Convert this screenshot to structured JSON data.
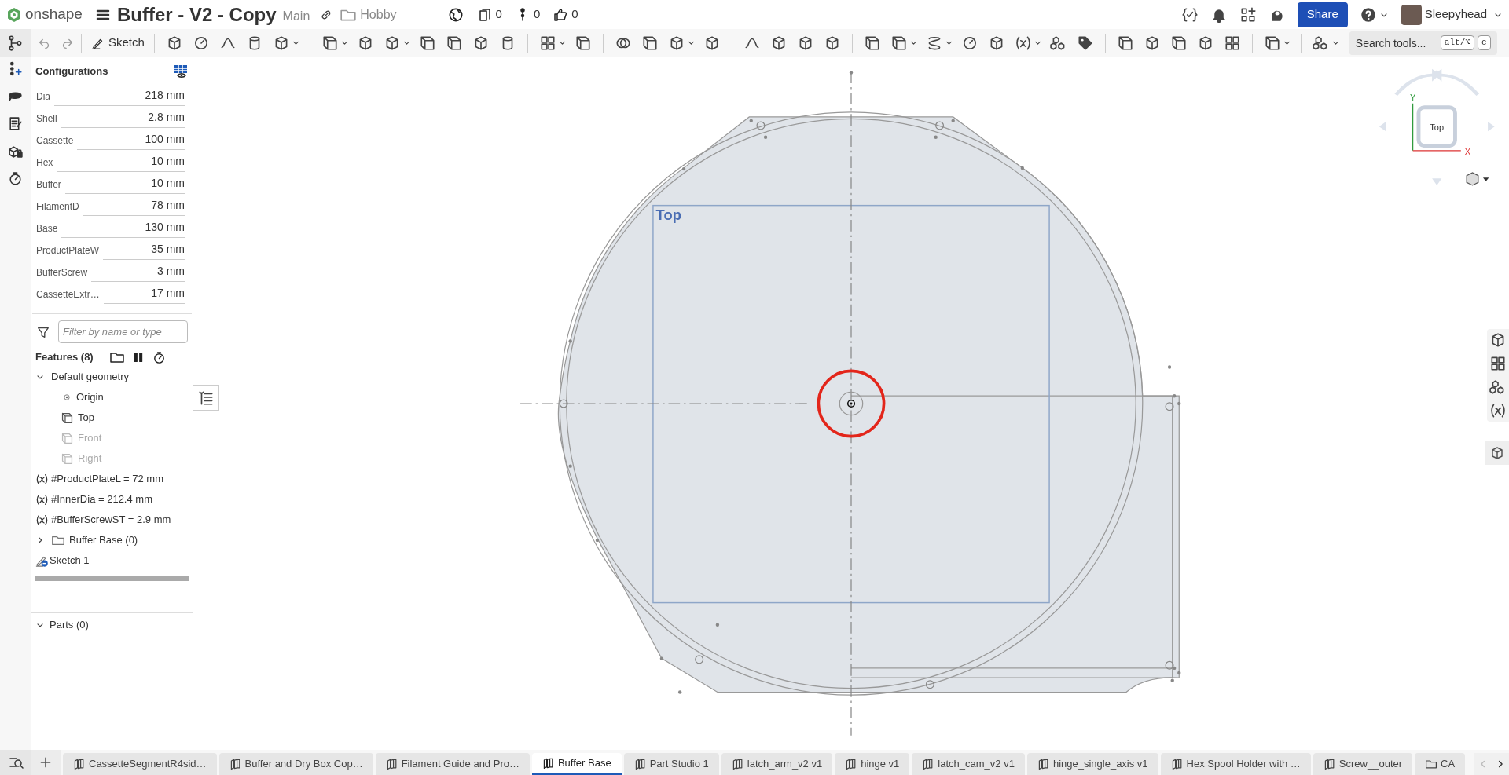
{
  "header": {
    "logo": "onshape",
    "title": "Buffer - V2 - Copy",
    "branch": "Main",
    "folder": "Hobby",
    "stats": [
      {
        "kind": "copies",
        "value": "0"
      },
      {
        "kind": "pins",
        "value": "0"
      },
      {
        "kind": "likes",
        "value": "0"
      }
    ],
    "share": "Share",
    "user": "Sleepyhead"
  },
  "toolbar": {
    "sketch": "Sketch",
    "search": {
      "placeholder": "Search tools...",
      "keys": [
        "alt/⌥",
        "c"
      ]
    }
  },
  "configurations": {
    "title": "Configurations",
    "rows": [
      {
        "name": "Dia",
        "value": "218 mm"
      },
      {
        "name": "Shell",
        "value": "2.8 mm"
      },
      {
        "name": "Cassette",
        "value": "100 mm"
      },
      {
        "name": "Hex",
        "value": "10 mm"
      },
      {
        "name": "Buffer",
        "value": "10 mm"
      },
      {
        "name": "FilamentD",
        "value": "78 mm"
      },
      {
        "name": "Base",
        "value": "130 mm"
      },
      {
        "name": "ProductPlateW",
        "value": "35 mm"
      },
      {
        "name": "BufferScrew",
        "value": "3 mm"
      },
      {
        "name": "CassetteExtr…",
        "value": "17 mm"
      }
    ]
  },
  "filter": {
    "placeholder": "Filter by name or type"
  },
  "features": {
    "title": "Features (8)",
    "tree": [
      {
        "label": "Default geometry",
        "kind": "group",
        "expanded": true,
        "children": [
          {
            "label": "Origin",
            "kind": "origin",
            "hidden": false
          },
          {
            "label": "Top",
            "kind": "plane",
            "hidden": false
          },
          {
            "label": "Front",
            "kind": "plane",
            "hidden": true
          },
          {
            "label": "Right",
            "kind": "plane",
            "hidden": true
          }
        ]
      },
      {
        "label": "#ProductPlateL = 72 mm",
        "kind": "variable"
      },
      {
        "label": "#InnerDia = 212.4 mm",
        "kind": "variable"
      },
      {
        "label": "#BufferScrewST = 2.9 mm",
        "kind": "variable"
      },
      {
        "label": "Buffer Base (0)",
        "kind": "folder",
        "expanded": false
      },
      {
        "label": "Sketch 1",
        "kind": "sketch"
      }
    ]
  },
  "parts": {
    "title": "Parts (0)",
    "expanded": true
  },
  "viewport": {
    "plane_label": "Top",
    "view_cube": {
      "face": "Top",
      "x_axis": "X",
      "y_axis": "Y"
    }
  },
  "tabs": [
    {
      "label": "CassetteSegmentR4sid…",
      "kind": "part_studio",
      "selected": false
    },
    {
      "label": "Buffer and Dry Box Cop…",
      "kind": "part_studio",
      "selected": false
    },
    {
      "label": "Filament Guide and Pro…",
      "kind": "part_studio",
      "selected": false
    },
    {
      "label": "Buffer Base",
      "kind": "part_studio",
      "selected": true
    },
    {
      "label": "Part Studio 1",
      "kind": "part_studio",
      "selected": false
    },
    {
      "label": "latch_arm_v2 v1",
      "kind": "part_studio",
      "selected": false
    },
    {
      "label": "hinge v1",
      "kind": "part_studio",
      "selected": false
    },
    {
      "label": "latch_cam_v2 v1",
      "kind": "part_studio",
      "selected": false
    },
    {
      "label": "hinge_single_axis v1",
      "kind": "part_studio",
      "selected": false
    },
    {
      "label": "Hex Spool Holder with …",
      "kind": "part_studio",
      "selected": false
    },
    {
      "label": "Screw__outer",
      "kind": "part_studio",
      "selected": false
    },
    {
      "label": "CA",
      "kind": "folder",
      "selected": false
    }
  ]
}
